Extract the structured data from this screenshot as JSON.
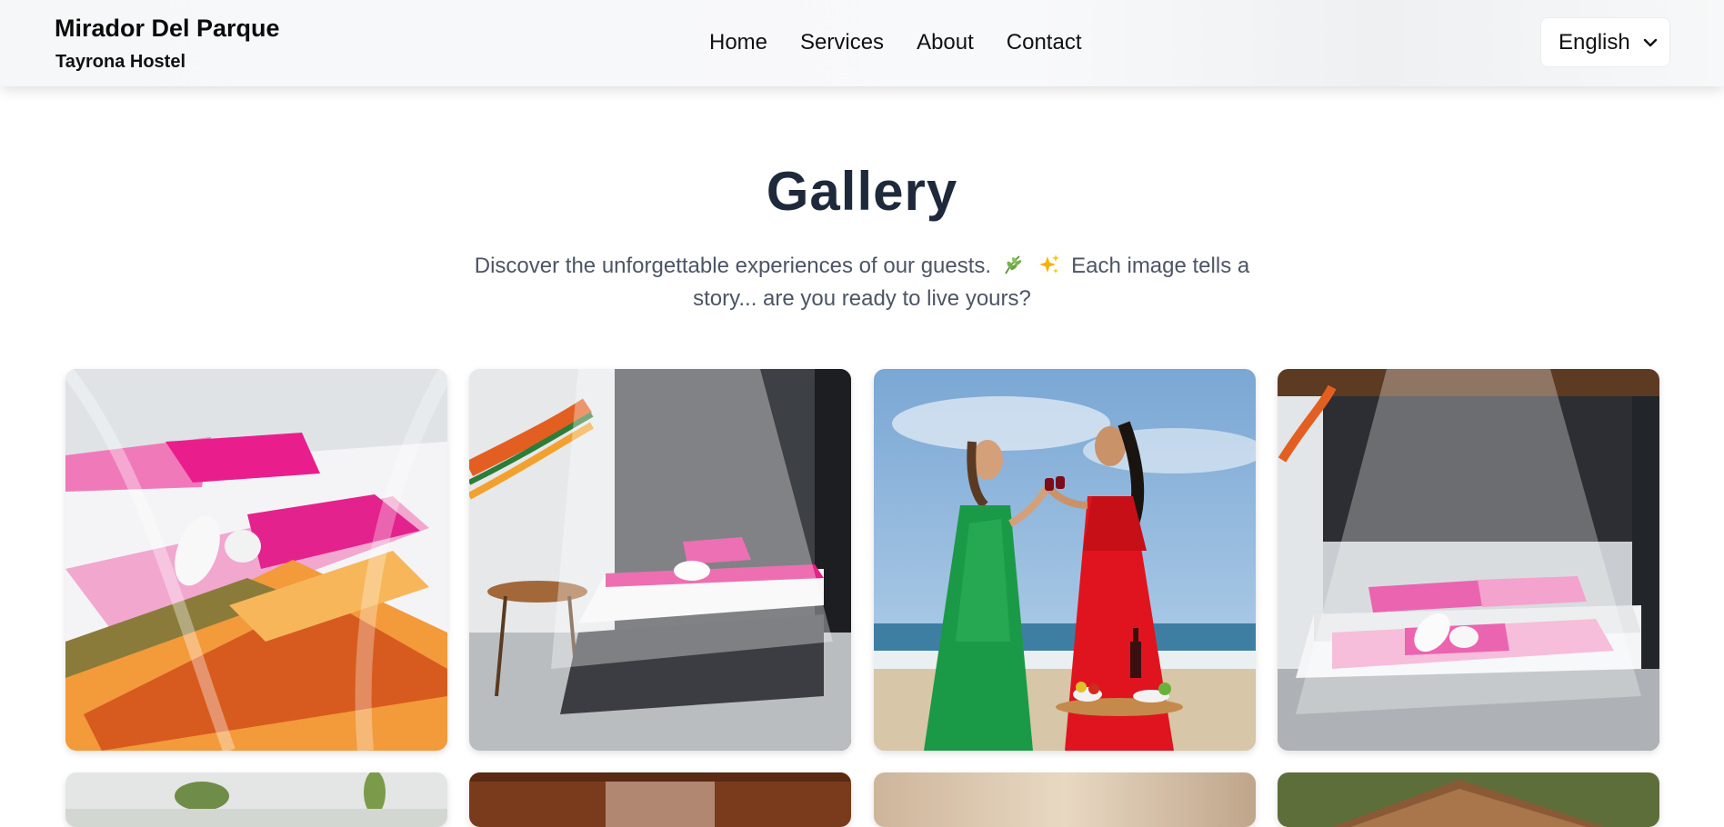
{
  "brand": {
    "title": "Mirador Del Parque",
    "subtitle": "Tayrona Hostel"
  },
  "nav": {
    "items": [
      "Home",
      "Services",
      "About",
      "Contact"
    ]
  },
  "language": {
    "selected": "English"
  },
  "gallery": {
    "title": "Gallery",
    "description_before": "Discover the unforgettable experiences of our guests.",
    "description_after": "Each image tells a story... are you ready to live yours?",
    "icons": [
      "herb-icon",
      "sparkles-icon"
    ],
    "photos": [
      {
        "subject": "bed-with-mosquito-net-and-hammock-photo"
      },
      {
        "subject": "canopy-bed-room-with-hammock-photo"
      },
      {
        "subject": "two-women-toasting-on-beach-photo"
      },
      {
        "subject": "canopy-bed-with-pink-linens-photo"
      },
      {
        "subject": "garden-palm-photo"
      },
      {
        "subject": "wooden-room-photo"
      },
      {
        "subject": "sunset-sky-photo"
      },
      {
        "subject": "thatched-roof-cabin-photo"
      }
    ]
  },
  "colors": {
    "heading": "#1e293b",
    "text": "#4b5565",
    "accent_pink": "#e0218a"
  }
}
